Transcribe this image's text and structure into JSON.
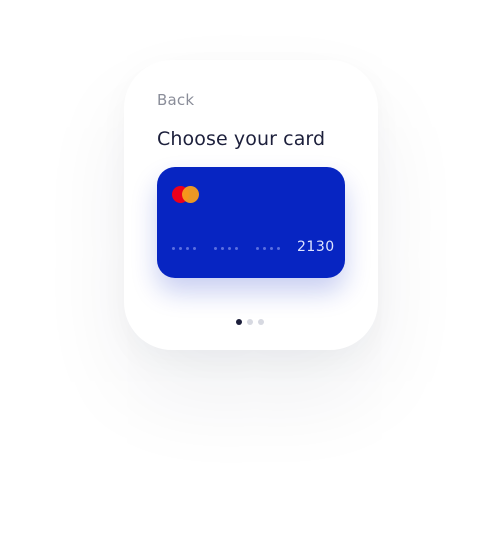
{
  "header": {
    "back_label": "Back",
    "title": "Choose your card"
  },
  "card": {
    "brand_icon": "mastercard-logo-icon",
    "masked_group_dots": 4,
    "masked_groups": 3,
    "last4": "2130",
    "color": "#0725c2"
  },
  "pager": {
    "count": 3,
    "active_index": 0
  }
}
